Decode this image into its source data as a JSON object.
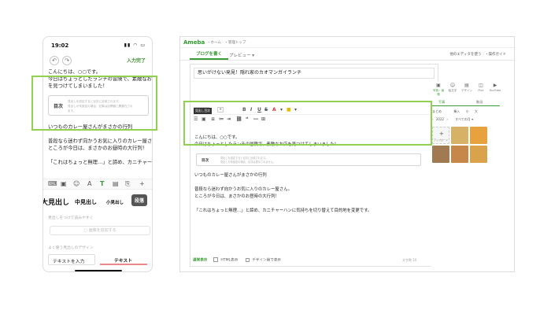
{
  "mobile": {
    "time": "19:02",
    "done_label": "入力完了",
    "body": [
      "こんにちは、○○です。",
      "今日はちょっとしたランチの冒険で、素敵なお店",
      "を見つけてしまいました！"
    ],
    "toc_label": "目次",
    "toc_desc": [
      "見出しを設定すると目次に反映されます。",
      "見出しが未設定の場合、記事は目標値と異要在され",
      "ます。"
    ],
    "heading_line": "いつものカレー屋さんがまさかの行列",
    "body2": [
      "普段なら迷わず向かうお気に入りのカレー屋さん。",
      "ところが今日は、まさかのお昼時の大行列！",
      "",
      "「これはちょっと無理…」と諦め、カニチャーハン"
    ],
    "heading_options": [
      "大見出し",
      "中見出し",
      "小見出し",
      "段落"
    ],
    "heading_note": "見出しをつけて読みやすく",
    "add_image": "画像を追加する",
    "design_note": "よく使う見出しのデザイン",
    "design_buttons": [
      "テキストを入力",
      "テキスト"
    ]
  },
  "desktop": {
    "logo": "Ameba",
    "breadcrumb": "・ホーム　・管理トップ",
    "tab_write": "ブログを書く",
    "tab_preview": "プレビュー ▾",
    "right_links": "他のエディタを使う　・操作ガイド",
    "title": "思いがけない発見！隠れ家のカオマンガイランチ",
    "tooltip": "見出し目次",
    "font_dd": "見出し",
    "body": [
      "こんにちは、○○です。",
      "今日はちょっとしたランチの冒険で、素敵なお店を見つけてしまいました！"
    ],
    "toc_label": "目次",
    "toc_desc": [
      "見出しを設定すると目次に反映されます。",
      "見出しが未設定の場合、目次は表示されません。"
    ],
    "heading_line": "いつものカレー屋さんがまさかの行列",
    "body2": [
      "普段なら迷わず向かうお気に入りのカレー屋さん。",
      "ところが今日は、まさかのお昼時の大行列！",
      "",
      "「これはちょっと無理…」と諦め、カニチャーハンに気持ちを切り替えて目的地を変更です。"
    ],
    "bottom_mode": "通常表示",
    "bottom_html": "HTML表示",
    "bottom_design": "デザイン崩で表示",
    "char_count": "文字数 16",
    "panel_tabs": [
      "写真・画像",
      "絵文字",
      "デザイン",
      "Pick",
      "YouTube"
    ],
    "panel_sub": [
      "写真",
      "動画"
    ],
    "panel_opts": [
      "まとめ",
      "挿入",
      "小",
      "大"
    ],
    "panel_date": "2022",
    "panel_all": "すべての月 ▾",
    "panel_upload": "アップロード"
  }
}
